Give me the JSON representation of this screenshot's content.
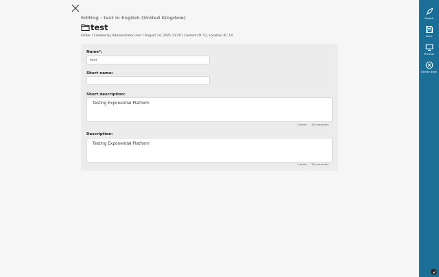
{
  "header": {
    "subtitle": "Editing - test in English (United Kingdom)",
    "title": "test",
    "meta": "Folder / Created by Administrator User / August 24, 2025 13:20 / Content ID: 52, Location ID: 54",
    "title_icon": "folder-icon",
    "close_icon": "close-icon"
  },
  "form": {
    "name_label": "Name*:",
    "name_value": "test",
    "short_name_label": "Short name:",
    "short_name_value": "",
    "short_description_label": "Short description:",
    "short_description_text": "Testing Exponential Platform",
    "short_description_words": "3 words",
    "short_description_chars": "28 characters",
    "description_label": "Description:",
    "description_text": "Testing Exponential Platform",
    "description_words": "3 words",
    "description_chars": "28 characters"
  },
  "sidebar": {
    "background": "#1b6f97",
    "items": [
      {
        "label": "Publish",
        "icon": "publish-icon"
      },
      {
        "label": "Save",
        "icon": "save-icon"
      },
      {
        "label": "Preview",
        "icon": "preview-icon"
      },
      {
        "label": "Delete draft",
        "icon": "delete-draft-icon"
      }
    ],
    "help_icon": "help-icon"
  }
}
